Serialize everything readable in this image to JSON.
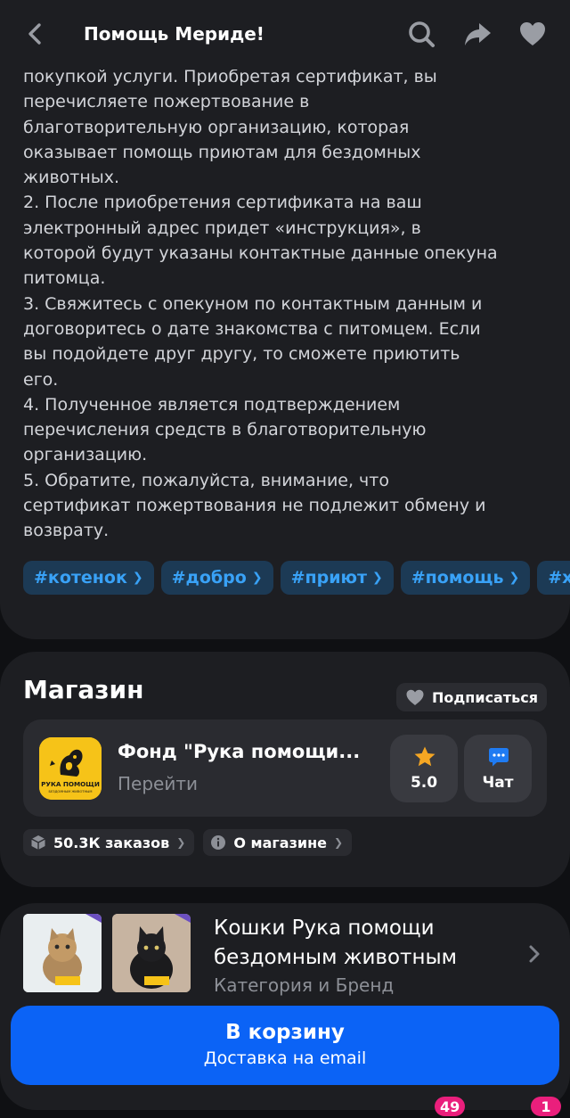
{
  "header": {
    "title": "Помощь Мериде!"
  },
  "description": {
    "text": "покупкой услуги. Приобретая сертификат, вы\nперечисляете пожертвование в\nблаготворительную организацию, которая\nоказывает помощь приютам для бездомных\nживотных.\n2. После приобретения сертификата на ваш\nэлектронный адрес придет «инструкция», в\nкоторой будут указаны контактные данные опекуна\nпитомца.\n3. Свяжитесь с опекуном по контактным данным и\nдоговоритесь о дате знакомства с питомцем. Если\nвы подойдете друг другу, то сможете приютить\nего.\n4. Полученное является подтверждением\nперечисления средств в благотворительную\nорганизацию.\n5. Обратите, пожалуйста, внимание, что\nсертификат пожертвования не подлежит обмену и\nвозврату."
  },
  "tags": [
    "#котенок",
    "#добро",
    "#приют",
    "#помощь",
    "#хв"
  ],
  "shop": {
    "section_title": "Магазин",
    "subscribe_label": "Подписаться",
    "name": "Фонд \"Рука помощи...",
    "go_label": "Перейти",
    "logo_text": "РУКА ПОМОЩИ",
    "logo_subtext": "БЕЗДОМНЫМ ЖИВОТНЫМ",
    "rating": "5.0",
    "chat_label": "Чат",
    "orders_chip": "50.3К заказов",
    "about_chip": "О магазине"
  },
  "category": {
    "title": "Кошки Рука помощи бездомным животным",
    "subtitle": "Категория и Бренд"
  },
  "cart": {
    "label": "В корзину",
    "sublabel": "Доставка на email"
  },
  "bottom_badges": [
    "49",
    "1"
  ],
  "colors": {
    "accent_blue": "#0b63f6",
    "tag_text": "#39a2f7",
    "badge": "#ea1f7c",
    "star": "#f5a623"
  }
}
